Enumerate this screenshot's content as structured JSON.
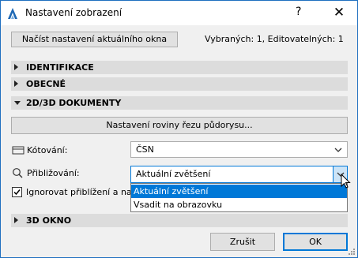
{
  "window": {
    "title": "Nastavení zobrazení",
    "help_label": "?",
    "close_label": "✕"
  },
  "toolbar": {
    "load_button": "Načíst nastavení aktuálního okna",
    "selection_info": "Vybraných: 1, Editovatelných: 1"
  },
  "sections": [
    {
      "label": "IDENTIFIKACE",
      "expanded": false
    },
    {
      "label": "OBECNÉ",
      "expanded": false
    },
    {
      "label": "2D/3D DOKUMENTY",
      "expanded": true
    },
    {
      "label": "3D OKNO",
      "expanded": false
    }
  ],
  "documents": {
    "cut_plane_button": "Nastavení roviny řezu půdorysu...",
    "dimensioning_label": "Kótování:",
    "dimensioning_value": "ČSN",
    "zoom_label": "Přibližování:",
    "zoom_value": "Aktuální zvětšení",
    "zoom_options": [
      "Aktuální zvětšení",
      "Vsadit na obrazovku"
    ],
    "ignore_label": "Ignorovat přiblížení a nato",
    "ignore_checked": true
  },
  "footer": {
    "cancel_label": "Zrušit",
    "ok_label": "OK"
  },
  "colors": {
    "accent": "#0078d7",
    "section_bg": "#dcdcdc",
    "app_icon": "#1d68b5"
  }
}
